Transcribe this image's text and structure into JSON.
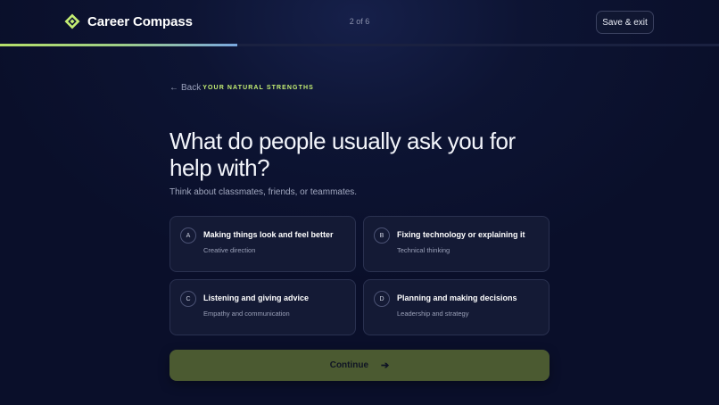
{
  "header": {
    "app_name": "Career Compass",
    "step_label": "2 of 6",
    "save_label": "Save & exit",
    "progress_percent": 33
  },
  "nav": {
    "back_label": "Back",
    "section_label": "YOUR NATURAL STRENGTHS"
  },
  "question": {
    "title": "What do people usually ask you for help with?",
    "hint": "Think about classmates, friends, or teammates."
  },
  "options": [
    {
      "letter": "A",
      "title": "Making things look and feel better",
      "subtitle": "Creative direction"
    },
    {
      "letter": "B",
      "title": "Fixing technology or explaining it",
      "subtitle": "Technical thinking"
    },
    {
      "letter": "C",
      "title": "Listening and giving advice",
      "subtitle": "Empathy and communication"
    },
    {
      "letter": "D",
      "title": "Planning and making decisions",
      "subtitle": "Leadership and strategy"
    }
  ],
  "footer": {
    "continue_label": "Continue"
  },
  "colors": {
    "accent": "#c4ee73",
    "background": "#0a0f2a",
    "continue_bg": "#4b5a31"
  },
  "icons": {
    "logo": "diamond-logo-icon",
    "back": "arrow-left-icon",
    "continue": "arrow-right-icon"
  }
}
